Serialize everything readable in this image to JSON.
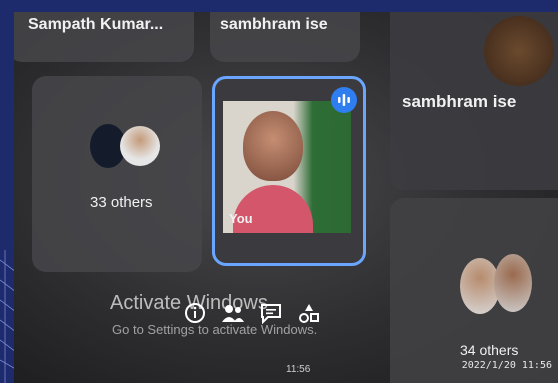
{
  "participants": {
    "top_left_name": "Sampath Kumar...",
    "top_mid_name": "sambhram ise",
    "right_name": "sambhram ise",
    "others_count_label": "33 others",
    "self_label": "You",
    "right_bottom_count_label": "34 others"
  },
  "watermark": {
    "title": "Activate Windows",
    "subtitle": "Go to Settings to activate Windows."
  },
  "taskbar": {
    "time": "11:56"
  },
  "camera_stamp": "2022/1/20 11:56",
  "colors": {
    "frame_blue": "#1d2a6b",
    "active_border": "#6aa6ff",
    "mic_button": "#2f7ef0"
  }
}
